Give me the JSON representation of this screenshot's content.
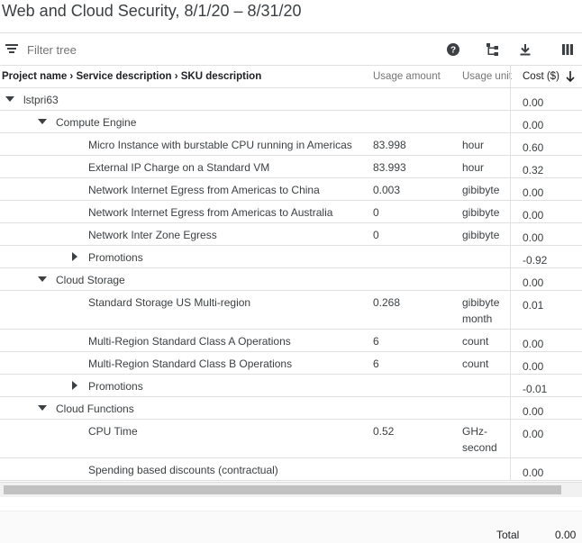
{
  "report": {
    "title": "Web and Cloud Security, 8/1/20 – 8/31/20"
  },
  "toolbar": {
    "filter_placeholder": "Filter tree",
    "icons": [
      "filter-list-icon",
      "help-icon",
      "hierarchy-icon",
      "download-icon",
      "columns-icon"
    ]
  },
  "table": {
    "headers": {
      "name": "Project name › Service description › SKU description",
      "usage_amount": "Usage amount",
      "usage_unit": "Usage unit",
      "cost": "Cost ($)"
    },
    "rows": [
      {
        "level": 0,
        "caret": "down",
        "name": "lstpri63",
        "amount": "",
        "unit": "",
        "cost": "0.00"
      },
      {
        "level": 1,
        "caret": "down",
        "name": "Compute Engine",
        "amount": "",
        "unit": "",
        "cost": "0.00"
      },
      {
        "level": 2,
        "caret": "",
        "name": "Micro Instance with burstable CPU running in Americas",
        "amount": "83.998",
        "unit": "hour",
        "cost": "0.60"
      },
      {
        "level": 2,
        "caret": "",
        "name": "External IP Charge on a Standard VM",
        "amount": "83.993",
        "unit": "hour",
        "cost": "0.32"
      },
      {
        "level": 2,
        "caret": "",
        "name": "Network Internet Egress from Americas to China",
        "amount": "0.003",
        "unit": "gibibyte",
        "cost": "0.00"
      },
      {
        "level": 2,
        "caret": "",
        "name": "Network Internet Egress from Americas to Australia",
        "amount": "0",
        "unit": "gibibyte",
        "cost": "0.00"
      },
      {
        "level": 2,
        "caret": "",
        "name": "Network Inter Zone Egress",
        "amount": "0",
        "unit": "gibibyte",
        "cost": "0.00"
      },
      {
        "level": 2,
        "caret": "right",
        "name": "Promotions",
        "amount": "",
        "unit": "",
        "cost": "-0.92"
      },
      {
        "level": 1,
        "caret": "down",
        "name": "Cloud Storage",
        "amount": "",
        "unit": "",
        "cost": "0.00"
      },
      {
        "level": 2,
        "caret": "",
        "name": "Standard Storage US Multi-region",
        "amount": "0.268",
        "unit": "gibibyte month",
        "cost": "0.01",
        "tall": true
      },
      {
        "level": 2,
        "caret": "",
        "name": "Multi-Region Standard Class A Operations",
        "amount": "6",
        "unit": "count",
        "cost": "0.00"
      },
      {
        "level": 2,
        "caret": "",
        "name": "Multi-Region Standard Class B Operations",
        "amount": "6",
        "unit": "count",
        "cost": "0.00"
      },
      {
        "level": 2,
        "caret": "right",
        "name": "Promotions",
        "amount": "",
        "unit": "",
        "cost": "-0.01"
      },
      {
        "level": 1,
        "caret": "down",
        "name": "Cloud Functions",
        "amount": "",
        "unit": "",
        "cost": "0.00"
      },
      {
        "level": 2,
        "caret": "",
        "name": "CPU Time",
        "amount": "0.52",
        "unit": "GHz-second",
        "cost": "0.00",
        "tall": true
      },
      {
        "level": 2,
        "caret": "",
        "name": "Spending based discounts (contractual)",
        "amount": "",
        "unit": "",
        "cost": "0.00"
      }
    ]
  },
  "footer": {
    "total_label": "Total",
    "total_value": "0.00"
  }
}
